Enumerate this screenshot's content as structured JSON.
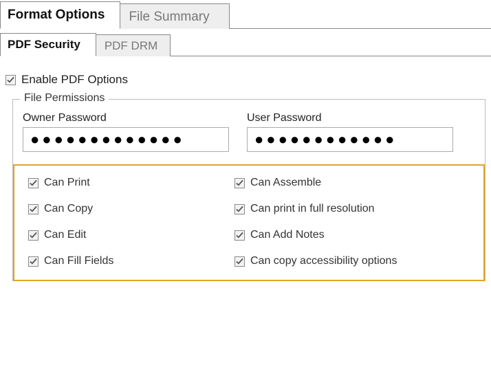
{
  "tabs_top": {
    "format_options": "Format Options",
    "file_summary": "File Summary"
  },
  "tabs_sub": {
    "pdf_security": "PDF Security",
    "pdf_drm": "PDF DRM"
  },
  "enable_pdf_options": {
    "label": "Enable PDF Options",
    "checked": true
  },
  "file_permissions": {
    "legend": "File Permissions",
    "owner_password": {
      "label": "Owner Password",
      "value": "●●●●●●●●●●●●●"
    },
    "user_password": {
      "label": "User Password",
      "value": "●●●●●●●●●●●●"
    },
    "perms": {
      "can_print": {
        "label": "Can Print",
        "checked": true
      },
      "can_assemble": {
        "label": "Can Assemble",
        "checked": true
      },
      "can_copy": {
        "label": "Can Copy",
        "checked": true
      },
      "can_full_res": {
        "label": "Can print in full resolution",
        "checked": true
      },
      "can_edit": {
        "label": "Can Edit",
        "checked": true
      },
      "can_add_notes": {
        "label": "Can Add Notes",
        "checked": true
      },
      "can_fill_fields": {
        "label": "Can Fill Fields",
        "checked": true
      },
      "can_copy_a11y": {
        "label": "Can copy accessibility options",
        "checked": true
      }
    }
  }
}
